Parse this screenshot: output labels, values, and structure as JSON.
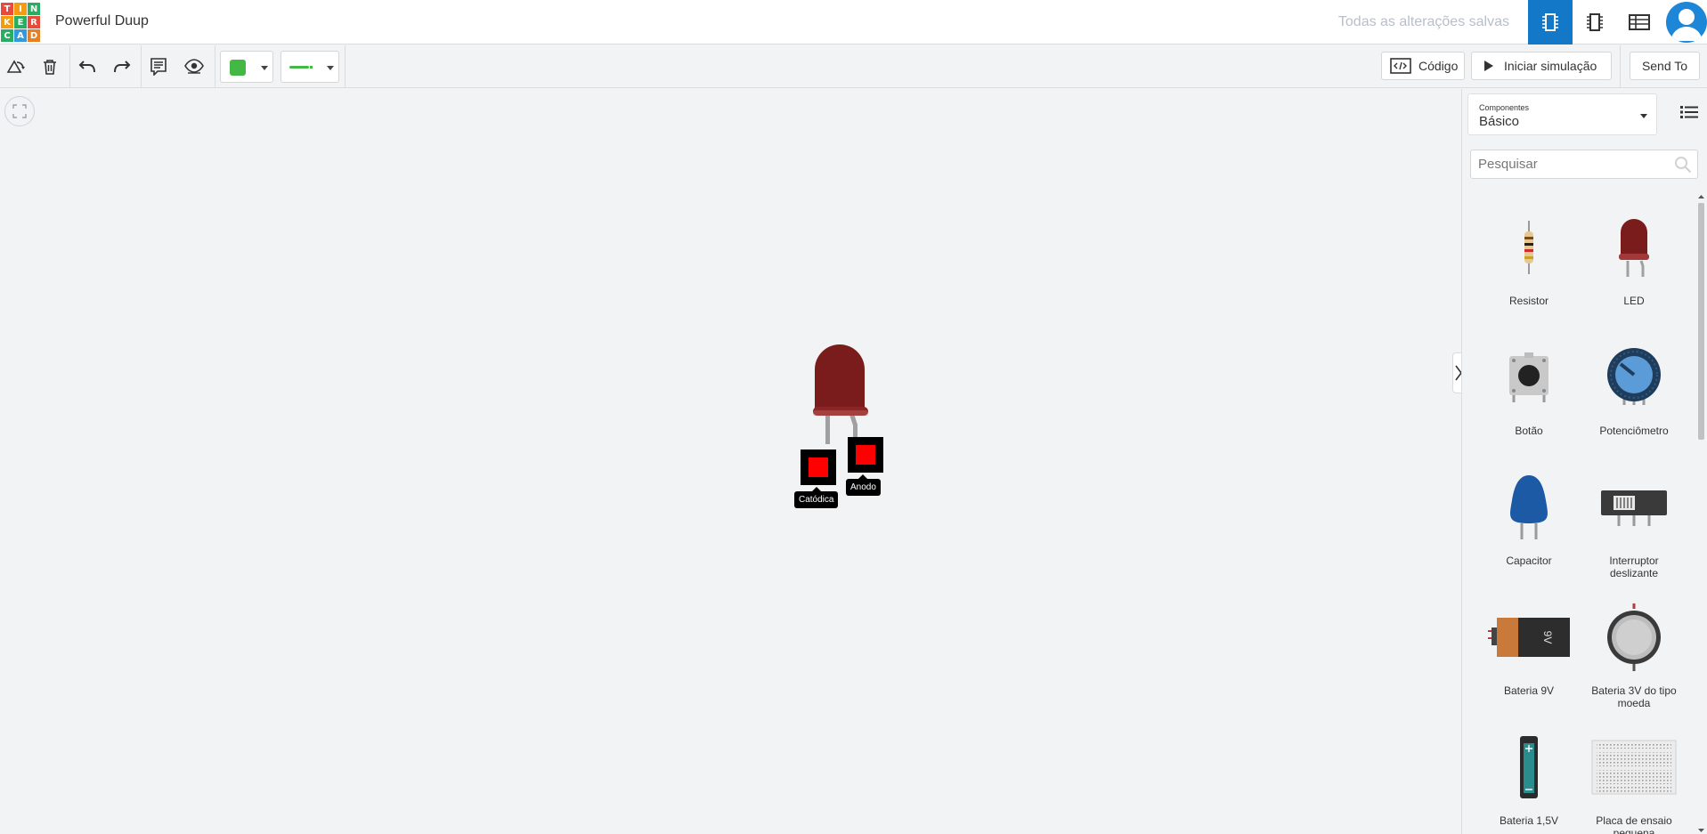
{
  "header": {
    "logo_letters": [
      "T",
      "I",
      "N",
      "K",
      "E",
      "R",
      "C",
      "A",
      "D"
    ],
    "logo_colors": [
      "#e84b3c",
      "#f39c12",
      "#27ae60",
      "#f39c12",
      "#27ae60",
      "#e84b3c",
      "#27ae60",
      "#3498db",
      "#e67e22"
    ],
    "project_title": "Powerful Duup",
    "save_status": "Todas as alterações salvas",
    "accent_color": "#1478c8"
  },
  "toolbar": {
    "color_value": "#44b844",
    "code_label": "Código",
    "simulate_label": "Iniciar simulação",
    "send_label": "Send To"
  },
  "canvas": {
    "led_color": "#7b1c1c",
    "pins": [
      {
        "label": "Catódica"
      },
      {
        "label": "Anodo"
      }
    ]
  },
  "panel": {
    "select_caption": "Componentes",
    "select_value": "Básico",
    "search_placeholder": "Pesquisar",
    "components": [
      {
        "label": "Resistor",
        "icon": "resistor-icon"
      },
      {
        "label": "LED",
        "icon": "led-icon"
      },
      {
        "label": "Botão",
        "icon": "pushbutton-icon"
      },
      {
        "label": "Potenciômetro",
        "icon": "potentiometer-icon"
      },
      {
        "label": "Capacitor",
        "icon": "capacitor-icon"
      },
      {
        "label": "Interruptor deslizante",
        "icon": "slide-switch-icon"
      },
      {
        "label": "Bateria 9V",
        "icon": "battery-9v-icon"
      },
      {
        "label": "Bateria 3V do tipo moeda",
        "icon": "coin-battery-icon"
      },
      {
        "label": "Bateria 1,5V",
        "icon": "battery-aa-icon"
      },
      {
        "label": "Placa de ensaio pequena",
        "icon": "breadboard-icon"
      }
    ],
    "battery_9v_text": "9V"
  }
}
